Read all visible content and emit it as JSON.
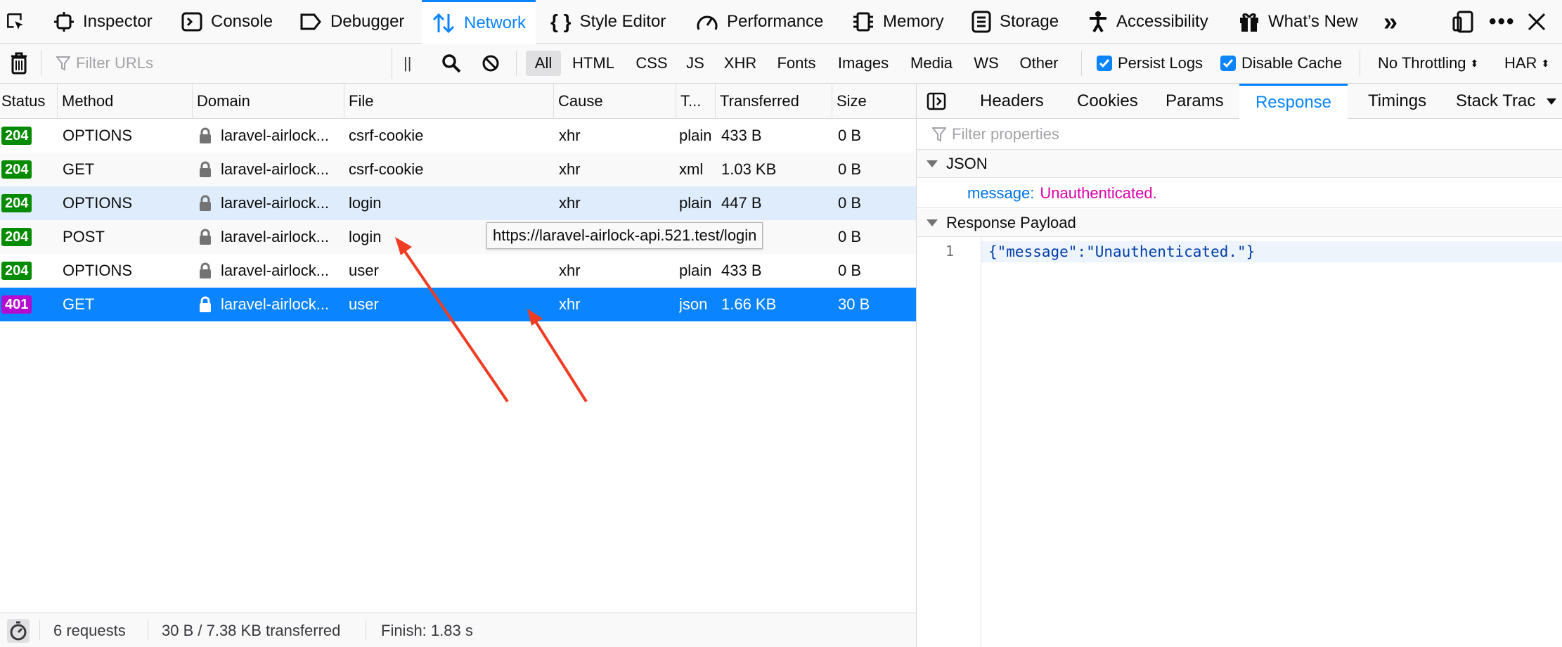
{
  "toolbar": {
    "tabs": [
      {
        "label": "Inspector",
        "icon": "inspector-icon"
      },
      {
        "label": "Console",
        "icon": "console-icon"
      },
      {
        "label": "Debugger",
        "icon": "debugger-icon"
      },
      {
        "label": "Network",
        "icon": "network-icon",
        "active": true
      },
      {
        "label": "Style Editor",
        "icon": "style-editor-icon"
      },
      {
        "label": "Performance",
        "icon": "performance-icon"
      },
      {
        "label": "Memory",
        "icon": "memory-icon"
      },
      {
        "label": "Storage",
        "icon": "storage-icon"
      },
      {
        "label": "Accessibility",
        "icon": "accessibility-icon"
      },
      {
        "label": "What’s New",
        "icon": "gift-icon"
      }
    ]
  },
  "filterbar": {
    "placeholder": "Filter URLs",
    "pause_glyph": "||",
    "types": [
      "All",
      "HTML",
      "CSS",
      "JS",
      "XHR",
      "Fonts",
      "Images",
      "Media",
      "WS",
      "Other"
    ],
    "active_type": "All",
    "persist_logs": "Persist Logs",
    "disable_cache": "Disable Cache",
    "throttling": "No Throttling",
    "har": "HAR"
  },
  "columns": [
    "Status",
    "Method",
    "Domain",
    "File",
    "Cause",
    "T...",
    "Transferred",
    "Size"
  ],
  "requests": [
    {
      "status": "204",
      "method": "OPTIONS",
      "domain": "laravel-airlock...",
      "file": "csrf-cookie",
      "cause": "xhr",
      "type": "plain",
      "transferred": "433 B",
      "size": "0 B"
    },
    {
      "status": "204",
      "method": "GET",
      "domain": "laravel-airlock...",
      "file": "csrf-cookie",
      "cause": "xhr",
      "type": "xml",
      "transferred": "1.03 KB",
      "size": "0 B"
    },
    {
      "status": "204",
      "method": "OPTIONS",
      "domain": "laravel-airlock...",
      "file": "login",
      "cause": "xhr",
      "type": "plain",
      "transferred": "447 B",
      "size": "0 B"
    },
    {
      "status": "204",
      "method": "POST",
      "domain": "laravel-airlock...",
      "file": "login",
      "cause": "",
      "type": "",
      "transferred": "",
      "size": "0 B"
    },
    {
      "status": "204",
      "method": "OPTIONS",
      "domain": "laravel-airlock...",
      "file": "user",
      "cause": "xhr",
      "type": "plain",
      "transferred": "433 B",
      "size": "0 B"
    },
    {
      "status": "401",
      "method": "GET",
      "domain": "laravel-airlock...",
      "file": "user",
      "cause": "xhr",
      "type": "json",
      "transferred": "1.66 KB",
      "size": "30 B"
    }
  ],
  "colors": {
    "status_204": "#058b00",
    "status_401": "#b30bcf",
    "accent": "#0a84ff"
  },
  "tooltip": "https://laravel-airlock-api.521.test/login",
  "statusbar": {
    "requests": "6 requests",
    "transferred": "30 B / 7.38 KB transferred",
    "finish": "Finish: 1.83 s"
  },
  "side": {
    "tabs": [
      "Headers",
      "Cookies",
      "Params",
      "Response",
      "Timings",
      "Stack Trac"
    ],
    "active_tab": "Response",
    "filter_placeholder": "Filter properties",
    "json_section": "JSON",
    "json_key": "message:",
    "json_value": "Unauthenticated.",
    "payload_section": "Response Payload",
    "line_number": "1",
    "payload": "{\"message\":\"Unauthenticated.\"}"
  }
}
